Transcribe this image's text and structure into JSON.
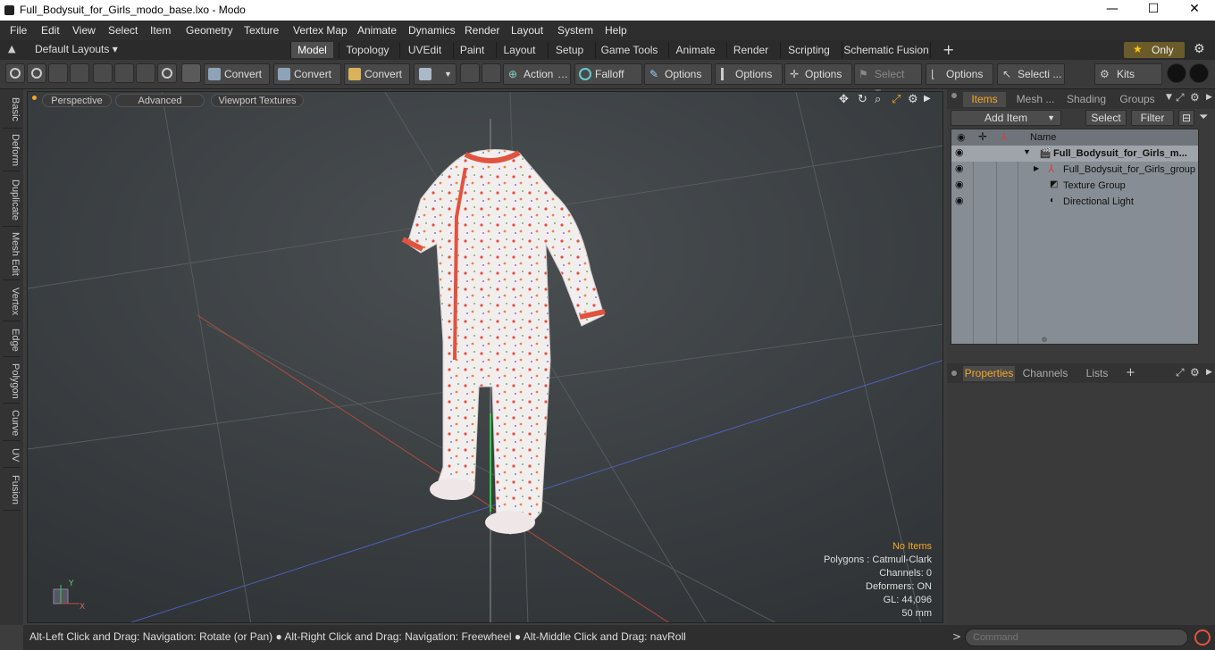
{
  "window": {
    "title": "Full_Bodysuit_for_Girls_modo_base.lxo - Modo",
    "min": "—",
    "max": "☐",
    "close": "✕"
  },
  "menu": [
    "File",
    "Edit",
    "View",
    "Select",
    "Item",
    "Geometry",
    "Texture",
    "Vertex Map",
    "Animate",
    "Dynamics",
    "Render",
    "Layout",
    "System",
    "Help"
  ],
  "layouts": {
    "selector": "Default Layouts ▾",
    "tabs": [
      "Model",
      "Topology",
      "UVEdit",
      "Paint",
      "Layout",
      "Setup",
      "Game Tools",
      "Animate",
      "Render",
      "Scripting",
      "Schematic Fusion"
    ],
    "active": "Model",
    "add": "+",
    "only": "Only",
    "star": "★"
  },
  "toolbar": {
    "convert1": "Convert",
    "convert2": "Convert",
    "convert3": "Convert",
    "action": "Action",
    "falloff": "Falloff",
    "options1": "Options",
    "options2": "Options",
    "options3": "Options",
    "select_t": "Select T...",
    "options4": "Options",
    "selecti": "Selecti ...",
    "kits": "Kits"
  },
  "left_tabs": [
    "Basic",
    "Deform",
    "Duplicate",
    "Mesh Edit",
    "Vertex",
    "Edge",
    "Polygon",
    "Curve",
    "UV",
    "Fusion"
  ],
  "viewport": {
    "perspective": "Perspective",
    "advanced": "Advanced",
    "textures": "Viewport Textures",
    "info": {
      "selection": "No Items",
      "polygons": "Polygons : Catmull-Clark",
      "channels": "Channels: 0",
      "deformers": "Deformers: ON",
      "gl": "GL: 44,096",
      "focal": "50 mm"
    },
    "axis_y": "Y",
    "axis_x": "X"
  },
  "status": "Alt-Left Click and Drag: Navigation: Rotate (or Pan) ● Alt-Right Click and Drag: Navigation: Freewheel ● Alt-Middle Click and Drag: navRoll",
  "panel_top": {
    "tabs": [
      "Items",
      "Mesh ...",
      "Shading",
      "Groups"
    ],
    "active": "Items",
    "add_item": "Add Item",
    "select": "Select",
    "filter": "Filter",
    "col_name": "Name",
    "items": [
      {
        "label": "Full_Bodysuit_for_Girls_m...",
        "bold": true
      },
      {
        "label": "Full_Bodysuit_for_Girls_group"
      },
      {
        "label": "Texture Group"
      },
      {
        "label": "Directional Light"
      }
    ]
  },
  "panel_bottom": {
    "tabs": [
      "Properties",
      "Channels",
      "Lists"
    ],
    "active": "Properties",
    "add": "+"
  },
  "command": {
    "placeholder": "Command",
    "prompt": ">"
  },
  "colors": {
    "accent": "#f5a623",
    "bodysuit_trim": "#e0533f"
  }
}
